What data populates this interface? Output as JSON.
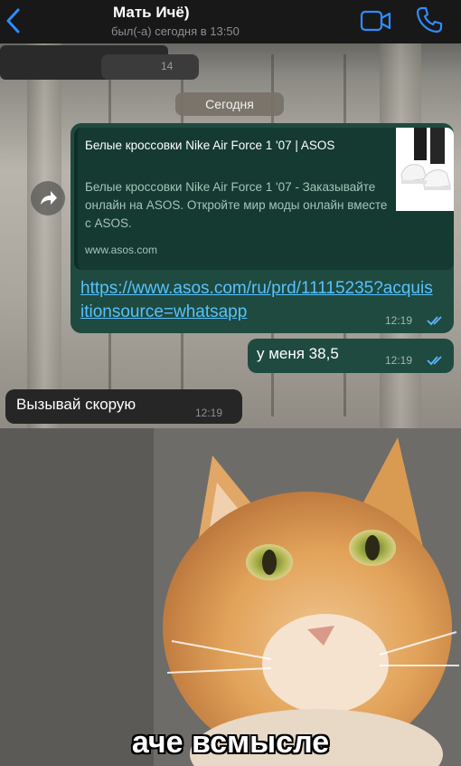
{
  "header": {
    "contact_name": "Мать Ичё)",
    "last_seen": "был(-а) сегодня в 13:50"
  },
  "redacted_message": {
    "time": "14"
  },
  "date_badge": "Сегодня",
  "link_message": {
    "preview_title": "Белые кроссовки Nike Air Force 1 '07 | ASOS",
    "preview_description": "Белые кроссовки Nike Air Force 1 '07 - Заказывайте онлайн на ASOS. Откройте мир моды онлайн вместе с ASOS.",
    "preview_domain": "www.asos.com",
    "link": "https://www.asos.com/ru/prd/11115235?acquisitionsource=whatsapp",
    "time": "12:19"
  },
  "size_message": {
    "text": "у меня 38,5",
    "time": "12:19"
  },
  "incoming_message": {
    "text": "Вызывай скорую",
    "time": "12:19"
  },
  "meme": {
    "caption": "аче всмысле"
  },
  "colors": {
    "outgoing_bubble": "#1f4a40",
    "incoming_bubble": "#262626",
    "link": "#56c2ff",
    "read_check": "#5ab7ff",
    "header_icon": "#2f8cff"
  },
  "icons": [
    "chevron-left-icon",
    "video-camera-icon",
    "phone-icon",
    "forward-arrow-icon",
    "double-check-icon"
  ]
}
